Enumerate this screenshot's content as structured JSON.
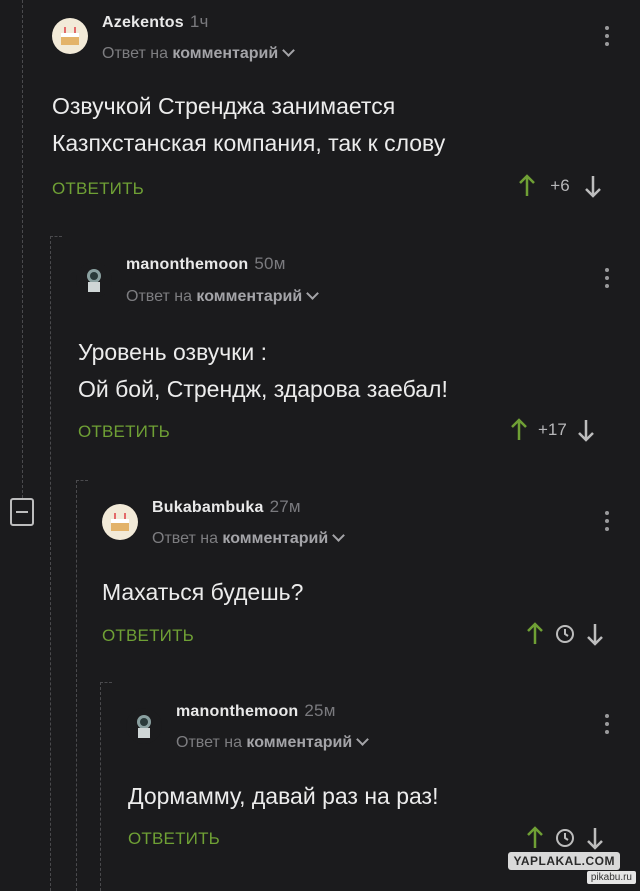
{
  "comments": [
    {
      "username": "Azekentos",
      "time": "1ч",
      "reply_prefix": "Ответ на",
      "reply_target": "комментарий",
      "lines": [
        "Озвучкой Стренджа занимается",
        "Казпхстанская компания, так к слову"
      ],
      "reply_label": "ОТВЕТИТЬ",
      "score": "+6",
      "avatar": "cake-icon"
    },
    {
      "username": "manonthemoon",
      "time": "50м",
      "reply_prefix": "Ответ на",
      "reply_target": "комментарий",
      "lines": [
        "Уровень озвучки :",
        "Ой бой, Стрендж, здарова заебал!"
      ],
      "reply_label": "ОТВЕТИТЬ",
      "score": "+17",
      "avatar": "astronaut-icon"
    },
    {
      "username": "Bukabambuka",
      "time": "27м",
      "reply_prefix": "Ответ на",
      "reply_target": "комментарий",
      "lines": [
        "Махаться будешь?"
      ],
      "reply_label": "ОТВЕТИТЬ",
      "score": "",
      "avatar": "cake-icon"
    },
    {
      "username": "manonthemoon",
      "time": "25м",
      "reply_prefix": "Ответ на",
      "reply_target": "комментарий",
      "lines": [
        "Дормамму, давай раз на раз!"
      ],
      "reply_label": "ОТВЕТИТЬ",
      "score": "",
      "avatar": "astronaut-icon"
    }
  ],
  "watermark": {
    "main": "YAPLAKAL.COM",
    "sub": "pikabu.ru"
  },
  "colors": {
    "background": "#1b1b1d",
    "accent": "#6fa035",
    "text": "#ececec"
  }
}
